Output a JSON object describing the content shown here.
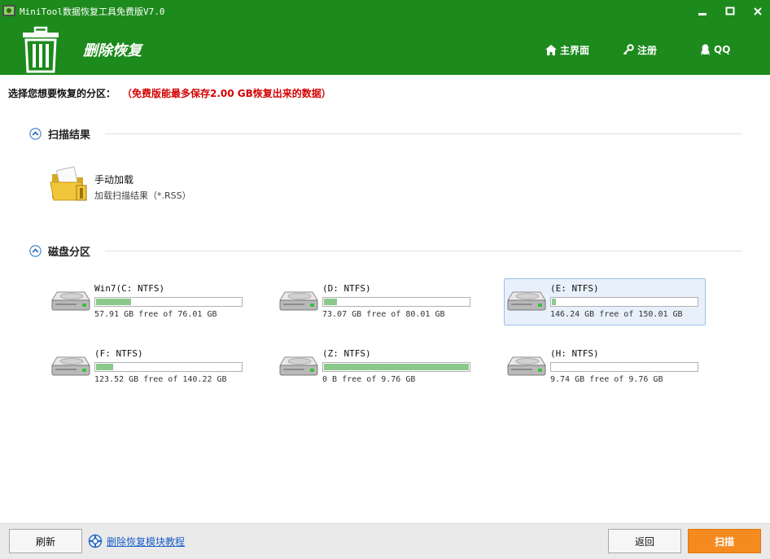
{
  "window": {
    "title": "MiniTool数据恢复工具免费版V7.0"
  },
  "header": {
    "title": "删除恢复",
    "nav": {
      "home": "主界面",
      "register": "注册",
      "qq": "QQ"
    }
  },
  "notice": {
    "prompt": "选择您想要恢复的分区：",
    "warning": "（免费版能最多保存2.00 GB恢复出来的数据）"
  },
  "scan_results": {
    "title": "扫描结果",
    "manual_load": {
      "title": "手动加载",
      "subtitle": "加载扫描结果（*.RSS）"
    }
  },
  "disk_partitions": {
    "title": "磁盘分区",
    "items": [
      {
        "name": "Win7(C: NTFS)",
        "free": "57.91 GB free of 76.01 GB",
        "used_fraction": 0.24,
        "selected": false
      },
      {
        "name": "(D: NTFS)",
        "free": "73.07 GB free of 80.01 GB",
        "used_fraction": 0.09,
        "selected": false
      },
      {
        "name": "(E: NTFS)",
        "free": "146.24 GB free of 150.01 GB",
        "used_fraction": 0.03,
        "selected": true
      },
      {
        "name": "(F: NTFS)",
        "free": "123.52 GB free of 140.22 GB",
        "used_fraction": 0.12,
        "selected": false
      },
      {
        "name": "(Z: NTFS)",
        "free": "0 B free of 9.76 GB",
        "used_fraction": 1.0,
        "selected": false
      },
      {
        "name": "(H: NTFS)",
        "free": "9.74 GB free of 9.76 GB",
        "used_fraction": 0.0,
        "selected": false
      }
    ]
  },
  "footer": {
    "refresh_label": "刷新",
    "help_link": "删除恢复模块教程",
    "back_label": "返回",
    "scan_label": "扫描"
  },
  "colors": {
    "brand_green": "#1c8a1c",
    "usage_fill": "#8cc88c",
    "warning_red": "#d40000",
    "scan_orange": "#f58a1f",
    "selected_bg": "#e8f0fb"
  }
}
